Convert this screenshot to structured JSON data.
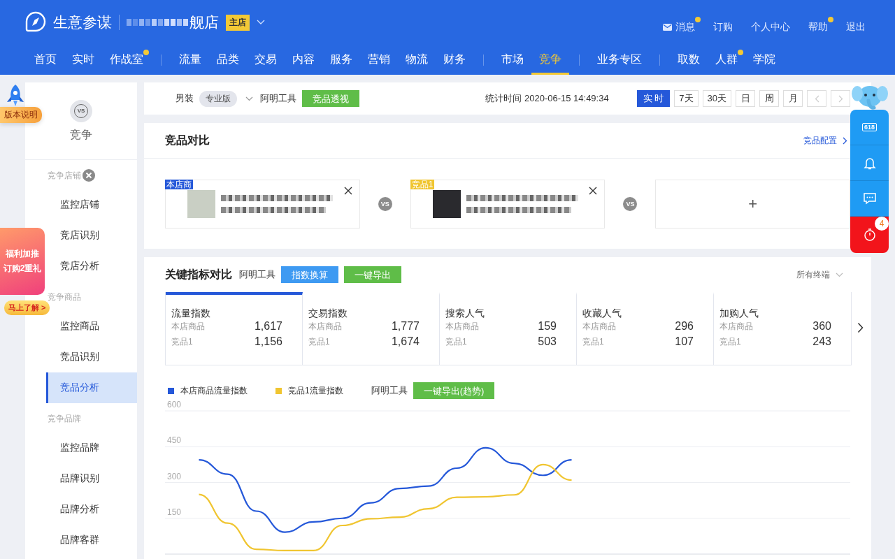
{
  "header": {
    "app_title": "生意参谋",
    "shop_name": "舰店",
    "shop_badge": "主店",
    "top_links": [
      {
        "label": "消息",
        "kind": "mail",
        "dot": true
      },
      {
        "label": "订购",
        "kind": "plain",
        "dot": false
      },
      {
        "label": "个人中心",
        "kind": "plain",
        "dot": false
      },
      {
        "label": "帮助",
        "kind": "plain",
        "dot": true
      },
      {
        "label": "退出",
        "kind": "plain",
        "dot": false
      }
    ],
    "nav_groups": [
      [
        {
          "label": "首页",
          "selected": false,
          "dot": false
        },
        {
          "label": "实时",
          "selected": false,
          "dot": false
        },
        {
          "label": "作战室",
          "selected": false,
          "dot": true
        }
      ],
      [
        {
          "label": "流量",
          "selected": false,
          "dot": false
        },
        {
          "label": "品类",
          "selected": false,
          "dot": false
        },
        {
          "label": "交易",
          "selected": false,
          "dot": false
        },
        {
          "label": "内容",
          "selected": false,
          "dot": false
        },
        {
          "label": "服务",
          "selected": false,
          "dot": false
        },
        {
          "label": "营销",
          "selected": false,
          "dot": false
        },
        {
          "label": "物流",
          "selected": false,
          "dot": false
        },
        {
          "label": "财务",
          "selected": false,
          "dot": false
        }
      ],
      [
        {
          "label": "市场",
          "selected": false,
          "dot": false
        },
        {
          "label": "竞争",
          "selected": true,
          "dot": false
        }
      ],
      [
        {
          "label": "业务专区",
          "selected": false,
          "dot": false
        }
      ],
      [
        {
          "label": "取数",
          "selected": false,
          "dot": false
        },
        {
          "label": "人群",
          "selected": false,
          "dot": true
        },
        {
          "label": "学院",
          "selected": false,
          "dot": false
        }
      ]
    ]
  },
  "left_widgets": {
    "version_note": "版本说明",
    "promo_lines": [
      "福利加推",
      "订购2重礼"
    ],
    "promo_cta": "马上了解 >"
  },
  "sidebar": {
    "icon_text": "VS",
    "title": "竞争",
    "groups": [
      {
        "label": "竞争店铺",
        "items": [
          {
            "label": "监控店铺",
            "selected": false
          },
          {
            "label": "竞店识别",
            "selected": false
          },
          {
            "label": "竞店分析",
            "selected": false
          }
        ]
      },
      {
        "label": "竞争商品",
        "items": [
          {
            "label": "监控商品",
            "selected": false
          },
          {
            "label": "竞品识别",
            "selected": false
          },
          {
            "label": "竞品分析",
            "selected": true
          }
        ]
      },
      {
        "label": "竞争品牌",
        "items": [
          {
            "label": "监控品牌",
            "selected": false
          },
          {
            "label": "品牌识别",
            "selected": false
          },
          {
            "label": "品牌分析",
            "selected": false
          },
          {
            "label": "品牌客群",
            "selected": false
          }
        ]
      }
    ]
  },
  "toolbar": {
    "category": "男装",
    "edition": "专业版",
    "tool_label": "阿明工具",
    "tool_button": "竞品透视",
    "stat_time": "统计时间 2020-06-15 14:49:34",
    "ranges": [
      {
        "label": "实 时",
        "selected": true
      },
      {
        "label": "7天",
        "selected": false
      },
      {
        "label": "30天",
        "selected": false
      },
      {
        "label": "日",
        "selected": false
      },
      {
        "label": "周",
        "selected": false
      },
      {
        "label": "月",
        "selected": false
      }
    ]
  },
  "compare": {
    "title": "竞品对比",
    "config_link": "竞品配置",
    "vs_marks": [
      "VS",
      "VS"
    ],
    "slots": [
      {
        "kind": "product",
        "tag": "本店商",
        "color": "#2558d9"
      },
      {
        "kind": "product",
        "tag": "竞品1",
        "color": "#f0c530"
      },
      {
        "kind": "add",
        "label": "+"
      }
    ]
  },
  "metrics": {
    "title": "关键指标对比",
    "tool_label": "阿明工具",
    "buttons": [
      {
        "label": "指数换算",
        "kind": "primary"
      },
      {
        "label": "一键导出",
        "kind": "success"
      }
    ],
    "terminal": "所有终端",
    "cards": [
      {
        "title": "流量指数",
        "selected": true,
        "rows": [
          {
            "label": "本店商品",
            "value": "1,617"
          },
          {
            "label": "竞品1",
            "value": "1,156"
          }
        ]
      },
      {
        "title": "交易指数",
        "selected": false,
        "rows": [
          {
            "label": "本店商品",
            "value": "1,777"
          },
          {
            "label": "竞品1",
            "value": "1,674"
          }
        ]
      },
      {
        "title": "搜索人气",
        "selected": false,
        "rows": [
          {
            "label": "本店商品",
            "value": "159"
          },
          {
            "label": "竞品1",
            "value": "503"
          }
        ]
      },
      {
        "title": "收藏人气",
        "selected": false,
        "rows": [
          {
            "label": "本店商品",
            "value": "296"
          },
          {
            "label": "竞品1",
            "value": "107"
          }
        ]
      },
      {
        "title": "加购人气",
        "selected": false,
        "rows": [
          {
            "label": "本店商品",
            "value": "360"
          },
          {
            "label": "竞品1",
            "value": "243"
          }
        ]
      }
    ],
    "trend": {
      "tool_label": "阿明工具",
      "export_button": "一键导出(趋势)",
      "chart_data": {
        "type": "line",
        "grid": true,
        "ylim": [
          0,
          600
        ],
        "yticks": [
          150,
          300,
          450,
          600
        ],
        "series": [
          {
            "name": "本店商品流量指数",
            "color": "#2558d9",
            "values": [
              null,
              395,
              335,
              180,
              92,
              135,
              150,
              215,
              275,
              285,
              360,
              445,
              380,
              330,
              395,
              null,
              null,
              null,
              null,
              null,
              null,
              null,
              null,
              null
            ]
          },
          {
            "name": "竞品1流量指数",
            "color": "#f0c530",
            "values": [
              null,
              250,
              130,
              20,
              15,
              15,
              120,
              148,
              155,
              190,
              238,
              240,
              248,
              375,
              310,
              null,
              null,
              null,
              null,
              null,
              null,
              null,
              null,
              null
            ]
          }
        ]
      }
    }
  },
  "float_bar": {
    "ticket_text": "618",
    "badge": "4"
  }
}
